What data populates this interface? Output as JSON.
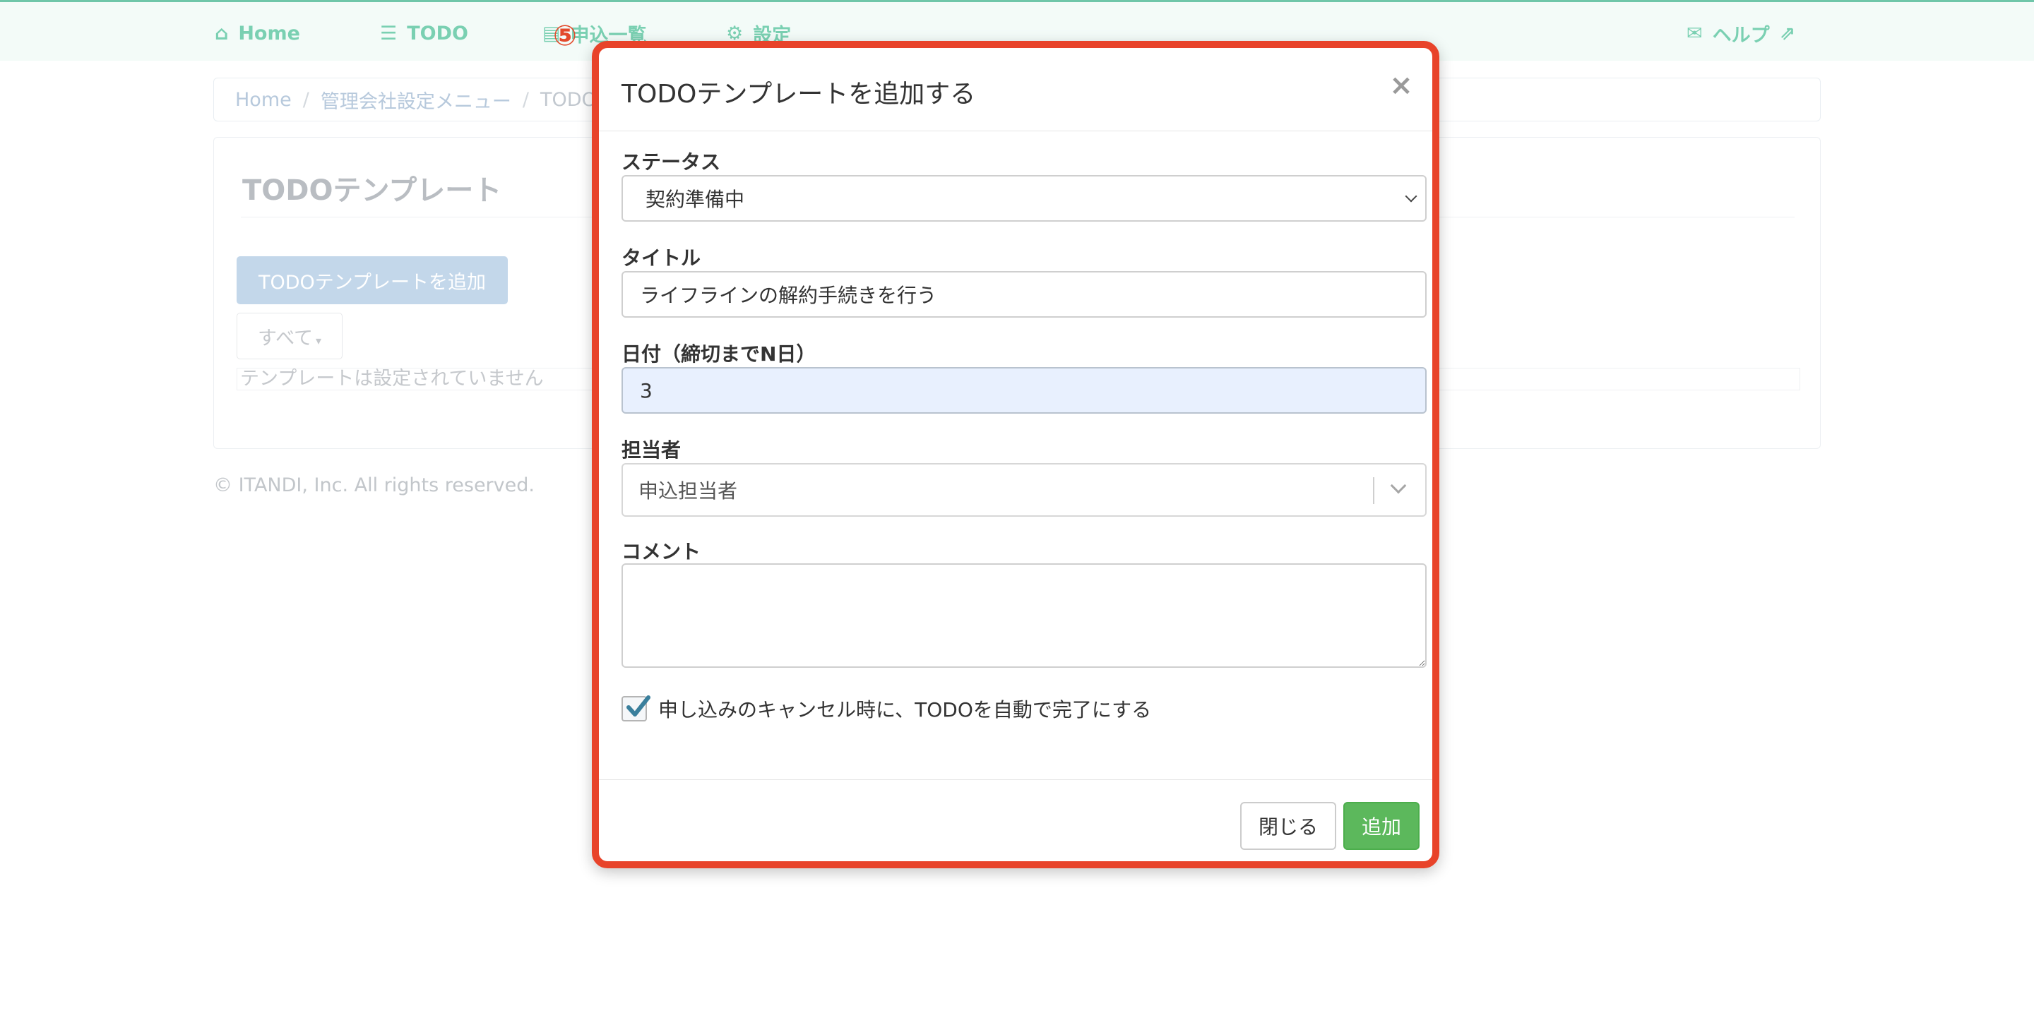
{
  "nav": {
    "home": "Home",
    "todo": "TODO",
    "applications": "申込一覧",
    "settings": "設定",
    "help": "ヘルプ",
    "icons": {
      "home": "home-icon",
      "todo": "list-icon",
      "applications": "document-icon",
      "settings": "gear-icon",
      "help": "envelope-icon",
      "external": "external-link-icon"
    }
  },
  "step_marker": "⑤",
  "breadcrumb": {
    "items": [
      "Home",
      "管理会社設定メニュー",
      "TODO"
    ]
  },
  "page": {
    "title": "TODOテンプレート",
    "add_button": "TODOテンプレートを追加",
    "filter_label": "すべて",
    "empty_message": "テンプレートは設定されていません"
  },
  "footer": {
    "copyright": "© ITANDI, Inc. All rights reserved."
  },
  "modal": {
    "title": "TODOテンプレートを追加する",
    "close_glyph": "×",
    "status": {
      "label": "ステータス",
      "value": "契約準備中"
    },
    "title_field": {
      "label": "タイトル",
      "value": "ライフラインの解約手続きを行う"
    },
    "date": {
      "label": "日付（締切までN日）",
      "value": "3"
    },
    "assignee": {
      "label": "担当者",
      "placeholder": "申込担当者"
    },
    "comment": {
      "label": "コメント",
      "value": ""
    },
    "auto_complete": {
      "label": "申し込みのキャンセル時に、TODOを自動で完了にする",
      "checked": true
    },
    "buttons": {
      "close": "閉じる",
      "add": "追加"
    }
  },
  "colors": {
    "highlight_border": "#e8432a",
    "nav_accent": "#7ad0b2",
    "add_button": "#5cb85c",
    "date_field_bg": "#e8f0fe",
    "checkbox_check": "#3a7f9c"
  }
}
